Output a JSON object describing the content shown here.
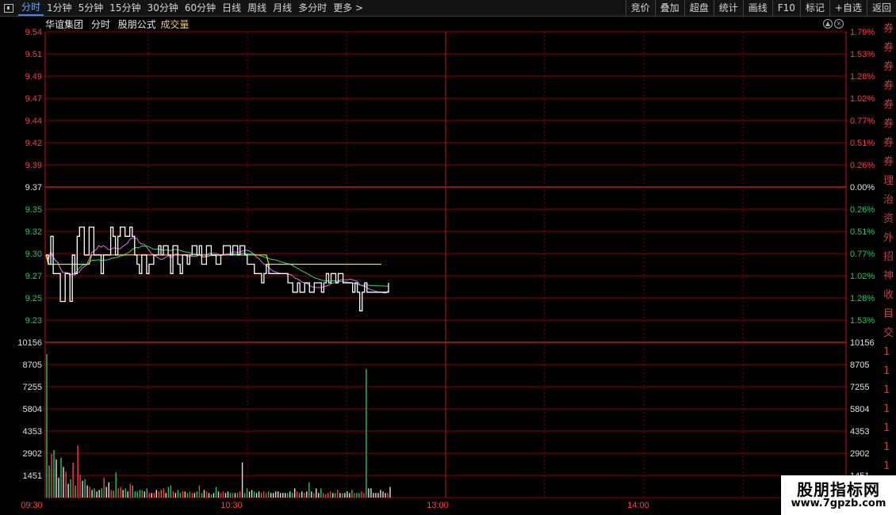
{
  "toolbar": {
    "periods": [
      "分时",
      "1分钟",
      "5分钟",
      "15分钟",
      "30分钟",
      "60分钟",
      "日线",
      "周线",
      "月线",
      "多分时",
      "更多 >"
    ],
    "active_period": "分时",
    "right_buttons": [
      "竞价",
      "叠加",
      "超盘",
      "统计",
      "画线",
      "F10",
      "标记",
      "+自选",
      "返回"
    ]
  },
  "info": {
    "stock_name": "华谊集团",
    "mode": "分时",
    "formula": "股朋公式",
    "indicator": "成交量"
  },
  "icons": {
    "up": "circle-up-icon",
    "close": "circle-close-icon"
  },
  "colors": {
    "grid": "#8b0000",
    "up": "#ff3b3b",
    "down": "#22c55e",
    "neutral": "#e0e0e0",
    "price": "#ffffff",
    "avg": "#e6e600",
    "ma_green": "#2fd37a",
    "ma_pink": "#e070e0",
    "time_text": "#ff4040"
  },
  "watermark": {
    "title": "股朋指标网",
    "url": "www.7gpzb.com"
  },
  "right_strip": [
    "券",
    "券",
    "券",
    "券",
    "券",
    "券",
    "券",
    "券",
    "理",
    "治",
    "资",
    "外",
    "招",
    "神",
    "收",
    "目",
    "交",
    "1",
    "1",
    "1",
    "1",
    "1",
    "1",
    "1"
  ],
  "chart_data": [
    {
      "type": "line",
      "title": "",
      "preclose": 9.37,
      "ylim": [
        9.23,
        9.54
      ],
      "left_ticks": [
        "9.54",
        "9.51",
        "9.49",
        "9.47",
        "9.44",
        "9.42",
        "9.39",
        "9.37",
        "9.35",
        "9.32",
        "9.30",
        "9.27",
        "9.25",
        "9.23"
      ],
      "right_ticks": [
        "1.79%",
        "1.53%",
        "1.28%",
        "1.02%",
        "0.77%",
        "0.51%",
        "0.26%",
        "0.00%",
        "0.26%",
        "0.51%",
        "0.77%",
        "1.02%",
        "1.28%",
        "1.53%"
      ],
      "x_labels": [
        "09:30",
        "10:30",
        "13:00",
        "14:00"
      ],
      "series": [
        {
          "name": "price",
          "values": [
            9.3,
            9.29,
            9.32,
            9.28,
            9.28,
            9.28,
            9.25,
            9.25,
            9.28,
            9.28,
            9.25,
            9.3,
            9.28,
            9.32,
            9.33,
            9.33,
            9.3,
            9.3,
            9.33,
            9.33,
            9.3,
            9.3,
            9.3,
            9.28,
            9.3,
            9.3,
            9.3,
            9.33,
            9.32,
            9.3,
            9.32,
            9.33,
            9.33,
            9.32,
            9.32,
            9.33,
            9.32,
            9.3,
            9.29,
            9.28,
            9.3,
            9.3,
            9.28,
            9.29,
            9.29,
            9.3,
            9.3,
            9.31,
            9.3,
            9.31,
            9.31,
            9.3,
            9.28,
            9.31,
            9.31,
            9.29,
            9.28,
            9.3,
            9.3,
            9.29,
            9.3,
            9.31,
            9.31,
            9.3,
            9.31,
            9.29,
            9.29,
            9.31,
            9.31,
            9.3,
            9.3,
            9.29,
            9.29,
            9.3,
            9.31,
            9.31,
            9.31,
            9.3,
            9.31,
            9.31,
            9.3,
            9.31,
            9.31,
            9.3,
            9.29,
            9.29,
            9.29,
            9.28,
            9.28,
            9.28,
            9.27,
            9.28,
            9.29,
            9.28,
            9.28,
            9.28,
            9.28,
            9.28,
            9.28,
            9.28,
            9.28,
            9.27,
            9.27,
            9.26,
            9.26,
            9.27,
            9.26,
            9.26,
            9.27,
            9.27,
            9.26,
            9.26,
            9.27,
            9.27,
            9.27,
            9.26,
            9.27,
            9.28,
            9.27,
            9.28,
            9.28,
            9.27,
            9.28,
            9.28,
            9.27,
            9.27,
            9.27,
            9.27,
            9.26,
            9.27,
            9.26,
            9.24,
            9.26,
            9.27,
            9.26,
            9.26,
            9.26,
            9.26,
            9.26,
            9.26,
            9.26,
            9.26,
            9.26,
            9.27
          ]
        },
        {
          "name": "avg",
          "values": [
            9.3,
            9.29,
            9.29,
            9.29,
            9.29,
            9.29,
            9.29,
            9.29,
            9.29,
            9.29,
            9.29,
            9.29,
            9.29,
            9.29,
            9.29,
            9.29,
            9.29,
            9.29,
            9.29,
            9.3,
            9.3,
            9.3,
            9.3,
            9.3,
            9.3,
            9.3,
            9.3,
            9.3,
            9.3,
            9.3,
            9.3,
            9.3,
            9.3,
            9.3,
            9.3,
            9.3,
            9.3,
            9.3,
            9.3,
            9.3,
            9.3,
            9.3,
            9.3,
            9.3,
            9.3,
            9.3,
            9.3,
            9.3,
            9.3,
            9.3,
            9.3,
            9.3,
            9.3,
            9.3,
            9.3,
            9.3,
            9.3,
            9.3,
            9.3,
            9.3,
            9.3,
            9.3,
            9.3,
            9.3,
            9.3,
            9.3,
            9.3,
            9.3,
            9.3,
            9.3,
            9.3,
            9.3,
            9.3,
            9.3,
            9.3,
            9.3,
            9.3,
            9.3,
            9.3,
            9.3,
            9.3,
            9.3,
            9.3,
            9.3,
            9.3,
            9.3,
            9.3,
            9.3,
            9.3,
            9.3,
            9.3,
            9.3,
            9.3,
            9.29,
            9.29,
            9.29,
            9.29,
            9.29,
            9.29,
            9.29,
            9.29,
            9.29,
            9.29,
            9.29,
            9.29,
            9.29,
            9.29,
            9.29,
            9.29,
            9.29,
            9.29,
            9.29,
            9.29,
            9.29,
            9.29,
            9.29,
            9.29,
            9.29,
            9.29,
            9.29,
            9.29,
            9.29,
            9.29,
            9.29,
            9.29,
            9.29,
            9.29,
            9.29,
            9.29,
            9.29,
            9.29,
            9.29,
            9.29,
            9.29,
            9.29,
            9.29,
            9.29,
            9.29,
            9.29,
            9.29,
            9.29
          ]
        }
      ]
    },
    {
      "type": "bar",
      "title": "成交量",
      "ylim": [
        0,
        10156
      ],
      "left_ticks": [
        "10156",
        "8705",
        "7255",
        "5804",
        "4353",
        "2902",
        "1451"
      ],
      "right_ticks": [
        "10156",
        "8705",
        "7255",
        "5804",
        "4353",
        "2902",
        "1451"
      ],
      "values": [
        9380,
        2100,
        2850,
        3100,
        2500,
        1300,
        2600,
        2000,
        1700,
        900,
        1200,
        2300,
        800,
        3400,
        1500,
        1100,
        1200,
        800,
        700,
        500,
        600,
        400,
        500,
        600,
        1300,
        700,
        1000,
        500,
        450,
        1650,
        600,
        700,
        500,
        600,
        400,
        900,
        800,
        400,
        400,
        500,
        500,
        400,
        600,
        300,
        300,
        300,
        500,
        400,
        500,
        600,
        300,
        700,
        800,
        400,
        300,
        500,
        300,
        400,
        400,
        300,
        400,
        300,
        300,
        400,
        800,
        300,
        500,
        400,
        300,
        200,
        300,
        700,
        400,
        300,
        400,
        300,
        400,
        300,
        300,
        300,
        300,
        400,
        2300,
        300,
        600,
        400,
        500,
        400,
        300,
        400,
        300,
        400,
        300,
        400,
        300,
        300,
        400,
        400,
        300,
        300,
        300,
        300,
        400,
        300,
        600,
        400,
        300,
        400,
        300,
        400,
        1000,
        400,
        300,
        600,
        300,
        600,
        300,
        200,
        300,
        400,
        300,
        300,
        500,
        300,
        300,
        300,
        400,
        300,
        500,
        300,
        300,
        300,
        400,
        300,
        8400,
        600,
        600,
        300,
        300,
        300,
        500,
        400,
        300,
        300,
        700
      ]
    }
  ]
}
